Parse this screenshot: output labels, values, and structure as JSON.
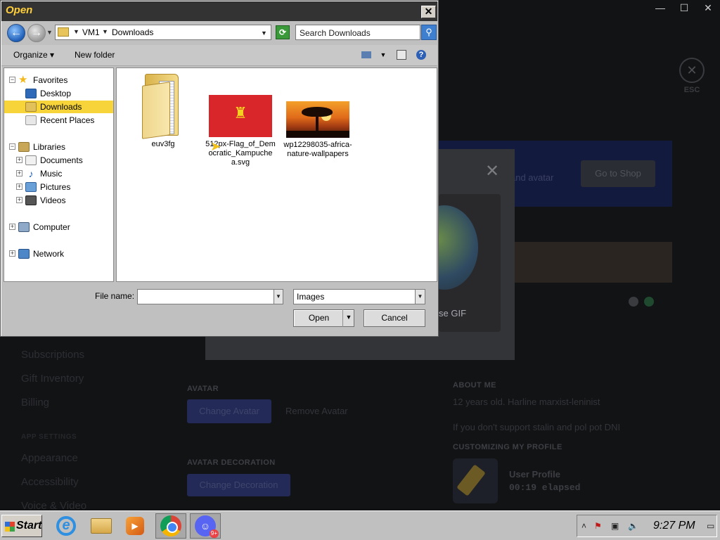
{
  "background_app": {
    "window_controls": [
      "—",
      "☐",
      "✕"
    ],
    "esc_label": "ESC",
    "sidebar": {
      "items": [
        "Subscriptions",
        "Gift Inventory",
        "Billing"
      ],
      "section_header": "APP SETTINGS",
      "settings_items": [
        "Appearance",
        "Accessibility",
        "Voice & Video"
      ]
    },
    "shop_banner_text": "and avatar",
    "shop_button": "Go to Shop",
    "gif_label": "se GIF",
    "avatar_section": {
      "header": "AVATAR",
      "change_button": "Change Avatar",
      "remove_button": "Remove Avatar"
    },
    "decoration_section": {
      "header": "AVATAR DECORATION",
      "change_button": "Change Decoration"
    },
    "about_me": {
      "header": "ABOUT ME",
      "line1": "12 years old. Harline marxist-leninist",
      "line2": "If you don't support stalin and pol pot DNI"
    },
    "customizing": {
      "header": "CUSTOMIZING MY PROFILE",
      "title": "User Profile",
      "elapsed": "00:19 elapsed"
    }
  },
  "dialog": {
    "title": "Open",
    "address": {
      "root": "VM1",
      "folder": "Downloads"
    },
    "search_placeholder": "Search Downloads",
    "toolbar": {
      "organize": "Organize",
      "new_folder": "New folder"
    },
    "nav_tree": [
      {
        "label": "Favorites",
        "icon": "star-icon"
      },
      {
        "label": "Desktop",
        "icon": "desktop-icon"
      },
      {
        "label": "Downloads",
        "icon": "downloads-folder-icon",
        "selected": true
      },
      {
        "label": "Recent Places",
        "icon": "recent-places-icon"
      },
      {
        "label": "Libraries",
        "icon": "libraries-icon"
      },
      {
        "label": "Documents",
        "icon": "documents-icon"
      },
      {
        "label": "Music",
        "icon": "music-icon"
      },
      {
        "label": "Pictures",
        "icon": "pictures-icon"
      },
      {
        "label": "Videos",
        "icon": "videos-icon"
      },
      {
        "label": "Computer",
        "icon": "computer-icon"
      },
      {
        "label": "Network",
        "icon": "network-icon"
      }
    ],
    "files": [
      {
        "name": "euv3fg",
        "type": "folder"
      },
      {
        "name": "512px-Flag_of_Democratic_Kampuchea.svg",
        "type": "image"
      },
      {
        "name": "wp12298035-africa-nature-wallpapers",
        "type": "image"
      }
    ],
    "file_name_label": "File name:",
    "file_name_value": "",
    "file_type_value": "Images",
    "open_button": "Open",
    "cancel_button": "Cancel"
  },
  "taskbar": {
    "start_label": "Start",
    "discord_badge": "9+",
    "clock": "9:27 PM"
  }
}
